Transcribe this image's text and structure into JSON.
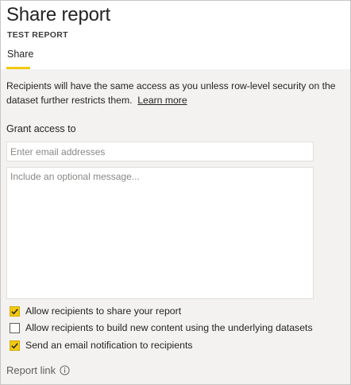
{
  "dialog": {
    "title": "Share report",
    "subtitle": "TEST REPORT"
  },
  "tabs": [
    {
      "label": "Share",
      "active": true
    }
  ],
  "info": {
    "text": "Recipients will have the same access as you unless row-level security on the dataset further restricts them.",
    "link_label": "Learn more"
  },
  "grant_access": {
    "label": "Grant access to",
    "email_placeholder": "Enter email addresses",
    "email_value": "",
    "message_placeholder": "Include an optional message...",
    "message_value": ""
  },
  "options": [
    {
      "label": "Allow recipients to share your report",
      "checked": true
    },
    {
      "label": "Allow recipients to build new content using the underlying datasets",
      "checked": false
    },
    {
      "label": "Send an email notification to recipients",
      "checked": true
    }
  ],
  "report_link": {
    "label": "Report link",
    "icon": "info-icon"
  },
  "colors": {
    "accent": "#f2c811",
    "panel_background": "#f3f2f1",
    "text": "#252423"
  }
}
